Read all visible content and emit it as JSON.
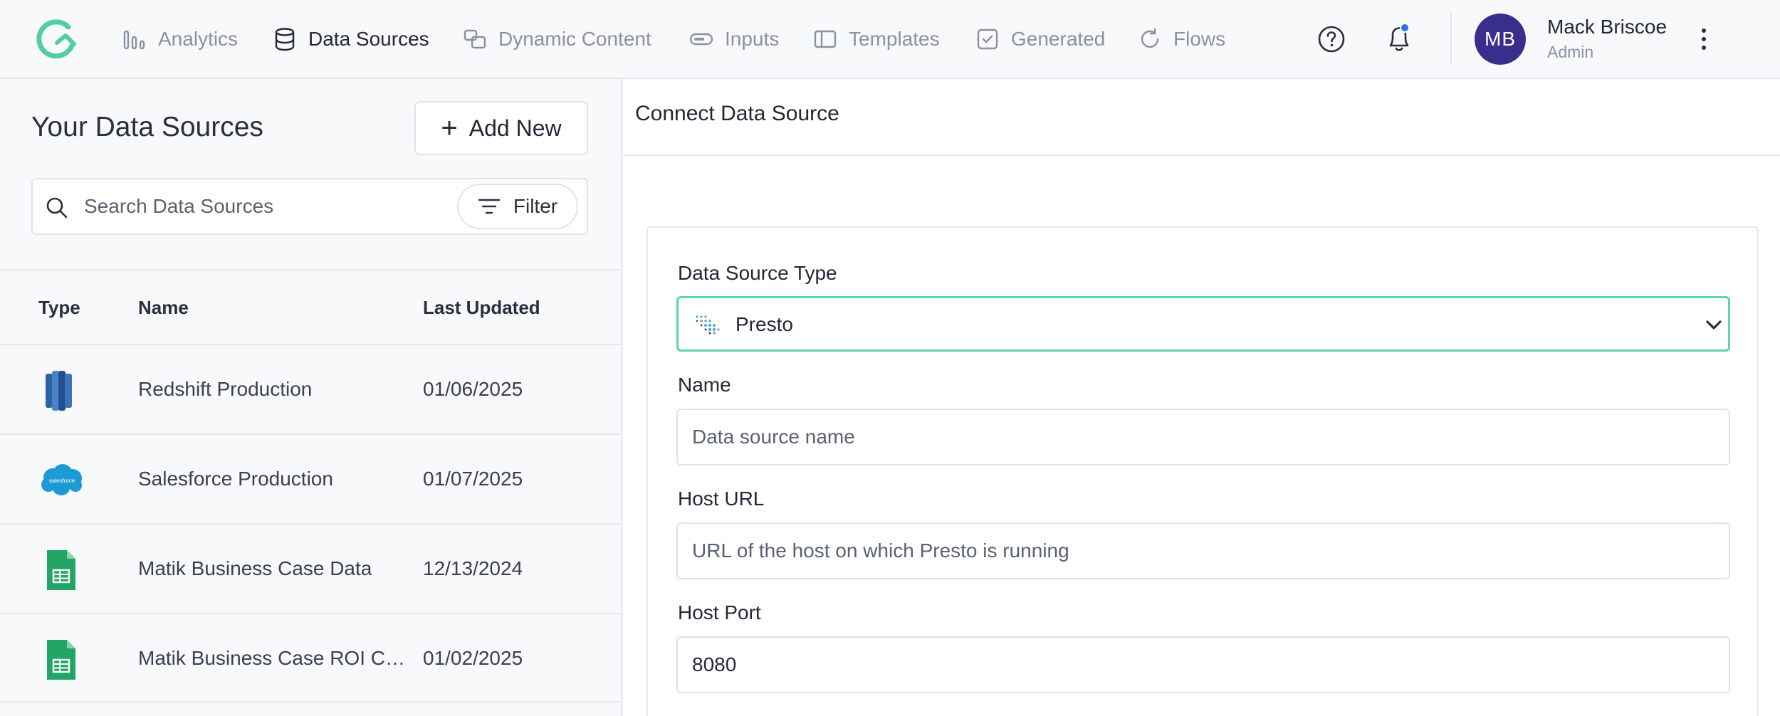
{
  "nav": {
    "items": [
      {
        "label": "Analytics",
        "icon": "bar-chart-icon",
        "active": false
      },
      {
        "label": "Data Sources",
        "icon": "database-icon",
        "active": true
      },
      {
        "label": "Dynamic Content",
        "icon": "dynamic-content-icon",
        "active": false
      },
      {
        "label": "Inputs",
        "icon": "toggle-icon",
        "active": false
      },
      {
        "label": "Templates",
        "icon": "template-icon",
        "active": false
      },
      {
        "label": "Generated",
        "icon": "check-square-icon",
        "active": false
      },
      {
        "label": "Flows",
        "icon": "refresh-icon",
        "active": false
      }
    ],
    "user": {
      "initials": "MB",
      "name": "Mack Briscoe",
      "role": "Admin"
    },
    "colors": {
      "accent": "#5fd4a4",
      "avatar": "#3a2e8c",
      "notification_dot": "#2f6fe0"
    }
  },
  "sidebar": {
    "title": "Your Data Sources",
    "add_new_label": "Add New",
    "search": {
      "placeholder": "Search Data Sources",
      "value": ""
    },
    "filter_label": "Filter",
    "columns": {
      "type": "Type",
      "name": "Name",
      "updated": "Last Updated"
    },
    "rows": [
      {
        "type": "redshift",
        "name": "Redshift Production",
        "updated": "01/06/2025"
      },
      {
        "type": "salesforce",
        "name": "Salesforce Production",
        "updated": "01/07/2025"
      },
      {
        "type": "google-sheets",
        "name": "Matik Business Case Data",
        "updated": "12/13/2024"
      },
      {
        "type": "google-sheets",
        "name": "Matik Business Case ROI Calculator",
        "updated": "01/02/2025"
      }
    ],
    "salesforce_logo_text": "salesforce"
  },
  "main": {
    "title": "Connect Data Source",
    "form": {
      "type_label": "Data Source Type",
      "type_value": "Presto",
      "name_label": "Name",
      "name_placeholder": "Data source name",
      "name_value": "",
      "host_url_label": "Host URL",
      "host_url_placeholder": "URL of the host on which Presto is running",
      "host_url_value": "",
      "host_port_label": "Host Port",
      "host_port_value": "8080"
    }
  }
}
